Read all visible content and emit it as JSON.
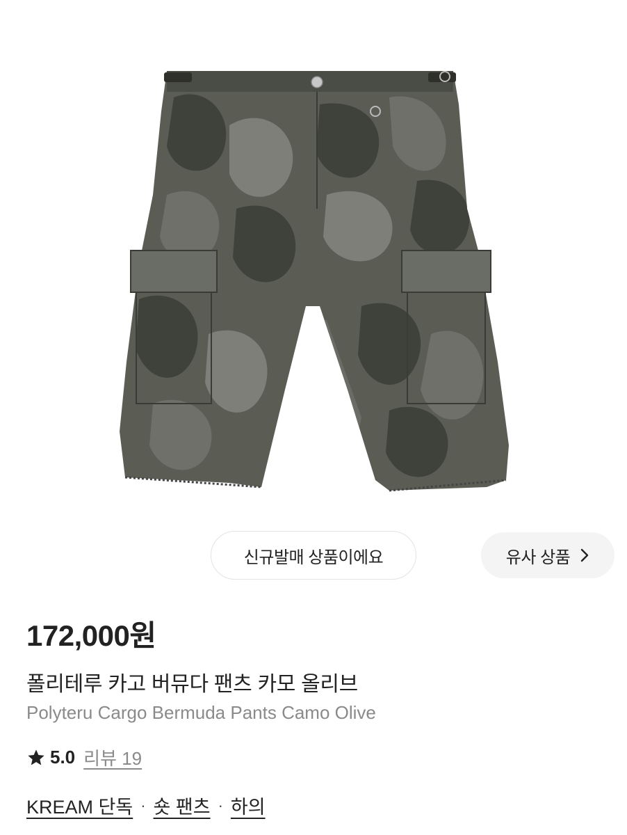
{
  "product": {
    "image_alt": "camo cargo bermuda shorts",
    "badges": {
      "new_release": "신규발매 상품이에요",
      "similar": "유사 상품"
    },
    "price": "172,000원",
    "name_ko": "폴리테루 카고 버뮤다 팬츠 카모 올리브",
    "name_en": "Polyteru Cargo Bermuda Pants Camo Olive",
    "rating": "5.0",
    "reviews": "리뷰 19",
    "breadcrumbs": [
      "KREAM 단독",
      "숏 팬츠",
      "하의"
    ],
    "separator": "·"
  },
  "colors": {
    "camo_base": "#5b5d55",
    "camo_dark": "#3f413b",
    "camo_mid": "#6e7069",
    "camo_light": "#7d7f78",
    "pill_bg": "#f4f4f4",
    "muted_text": "#8a8a8a"
  },
  "icons": {
    "rating": "star-icon",
    "similar": "chevron-right-icon"
  }
}
